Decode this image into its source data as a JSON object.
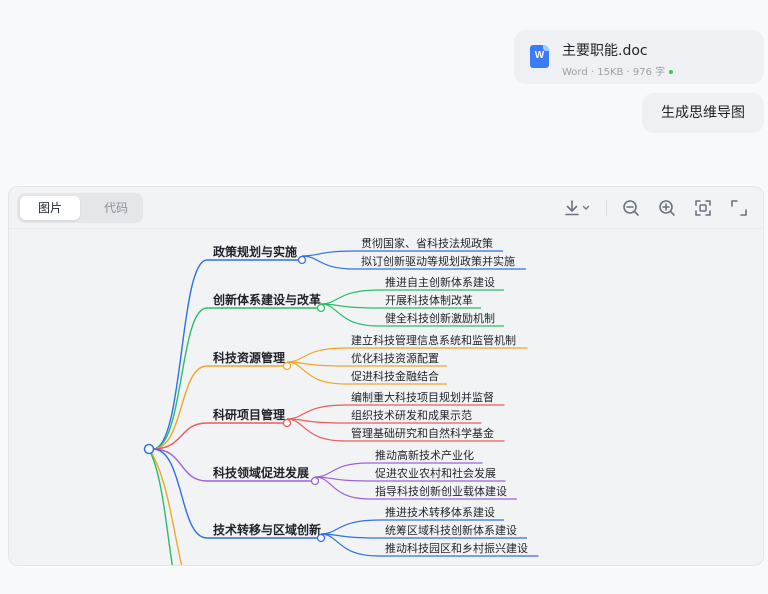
{
  "attachment": {
    "file_name": "主要职能.doc",
    "icon_letter": "W",
    "meta": "Word · 15KB · 976 字",
    "icon": "word-doc-icon"
  },
  "user_message": {
    "text": "生成思维导图"
  },
  "viewer": {
    "tabs": [
      {
        "label": "图片",
        "active": true
      },
      {
        "label": "代码",
        "active": false
      }
    ],
    "tools": [
      "download-icon",
      "chevron-down-icon",
      "zoom-out-icon",
      "zoom-in-icon",
      "fit-screen-icon",
      "fullscreen-icon"
    ]
  },
  "mindmap": {
    "branches": [
      {
        "title": "政策规划与实施",
        "color": "#2f6fe8",
        "items": [
          "贯彻国家、省科技法规政策",
          "拟订创新驱动等规划政策并实施"
        ]
      },
      {
        "title": "创新体系建设与改革",
        "color": "#2bbd6a",
        "items": [
          "推进自主创新体系建设",
          "开展科技体制改革",
          "健全科技创新激励机制"
        ]
      },
      {
        "title": "科技资源管理",
        "color": "#f2a629",
        "items": [
          "建立科技管理信息系统和监管机制",
          "优化科技资源配置",
          "促进科技金融结合"
        ]
      },
      {
        "title": "科研项目管理",
        "color": "#ea5b5b",
        "items": [
          "编制重大科技项目规划并监督",
          "组织技术研发和成果示范",
          "管理基础研究和自然科学基金"
        ]
      },
      {
        "title": "科技领域促进发展",
        "color": "#9b63d9",
        "items": [
          "推动高新技术产业化",
          "促进农业农村和社会发展",
          "指导科技创新创业载体建设"
        ]
      },
      {
        "title": "技术转移与区域创新",
        "color": "#2f6fe8",
        "items": [
          "推进技术转移体系建设",
          "统筹区域科技创新体系建设",
          "推动科技园区和乡村振兴建设"
        ]
      }
    ]
  }
}
